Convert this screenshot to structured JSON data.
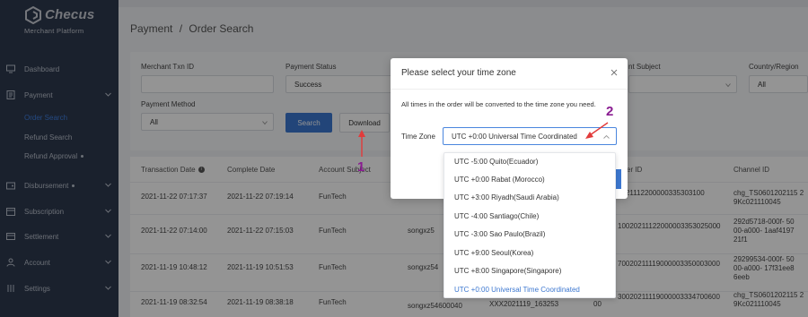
{
  "brand": {
    "name": "Checus",
    "subtitle": "Merchant   Platform"
  },
  "sidebar": {
    "items": [
      {
        "label": "Dashboard",
        "icon": "monitor-icon"
      },
      {
        "label": "Payment",
        "icon": "document-icon"
      },
      {
        "label": "Disbursement",
        "icon": "wallet-icon"
      },
      {
        "label": "Subscription",
        "icon": "calendar-icon"
      },
      {
        "label": "Settlement",
        "icon": "card-icon"
      },
      {
        "label": "Account",
        "icon": "user-icon"
      },
      {
        "label": "Settings",
        "icon": "settings-icon"
      }
    ],
    "payment_sub": [
      {
        "label": "Order Search",
        "active": true
      },
      {
        "label": "Refund Search"
      },
      {
        "label": "Refund Approval"
      }
    ]
  },
  "breadcrumb": {
    "parent": "Payment",
    "sep": "/",
    "current": "Order Search"
  },
  "filters": {
    "merchant_txn_label": "Merchant Txn ID",
    "payment_status_label": "Payment Status",
    "payment_status_value": "Success",
    "account_subject_label": "nt Subject",
    "country_label": "Country/Region",
    "country_value": "All",
    "payment_method_label": "Payment Method",
    "payment_method_value": "All",
    "search_label": "Search",
    "download_label": "Download"
  },
  "table": {
    "headers": [
      "Transaction Date",
      "Complete Date",
      "Account Subject",
      "er ID",
      "Channel ID"
    ],
    "rows": [
      {
        "txn": "2021-11-22 07:17:37",
        "complete": "2021-11-22 07:19:14",
        "subject": "FunTech",
        "merchant_frag": "",
        "order": "2021112200000335303100",
        "channel": "chg_TS0601202115 29Kc021110045"
      },
      {
        "txn": "2021-11-22 07:14:00",
        "complete": "2021-11-22 07:15:03",
        "subject": "FunTech",
        "merchant_frag": "songxz5",
        "order": "10020211122000003353025000",
        "channel": "292d5718-000f- 5000-a000- 1aaf419721f1"
      },
      {
        "txn": "2021-11-19 10:48:12",
        "complete": "2021-11-19 10:51:53",
        "subject": "FunTech",
        "merchant_frag": "songxz54",
        "order": "70020211119000003350003000",
        "channel": "29299534-000f- 5000-a000- 17f31ee86eeb"
      },
      {
        "txn": "2021-11-19 08:32:54",
        "complete": "2021-11-19 08:38:18",
        "subject": "FunTech",
        "merchant_frag": "songxz54600040",
        "order": "30020211119000003334700600",
        "channel": "chg_TS0601202115 29Kc021110045"
      }
    ],
    "partial": {
      "a": "XXX2021119_163253",
      "b": "00"
    }
  },
  "modal": {
    "title": "Please select your time zone",
    "description": "All times in the order will be converted to the time zone you need.",
    "tz_label": "Time Zone",
    "tz_value": "UTC +0:00 Universal Time Coordinated"
  },
  "timezone_options": [
    {
      "label": "UTC -5:00 Quito(Ecuador)"
    },
    {
      "label": "UTC +0:00 Rabat (Morocco)"
    },
    {
      "label": "UTC +3:00 Riyadh(Saudi Arabia)"
    },
    {
      "label": "UTC -4:00 Santiago(Chile)"
    },
    {
      "label": "UTC -3:00 Sao Paulo(Brazil)"
    },
    {
      "label": "UTC +9:00 Seoul(Korea)"
    },
    {
      "label": "UTC +8:00 Singapore(Singapore)"
    },
    {
      "label": "UTC +0:00 Universal Time Coordinated",
      "selected": true
    }
  ],
  "annotations": {
    "step1": "1",
    "step2": "2"
  },
  "colors": {
    "sidebar": "#2e3a4f",
    "primary": "#3c77d0",
    "annotation_arrow": "#e23b3b",
    "annotation_num": "#8a1c91"
  }
}
